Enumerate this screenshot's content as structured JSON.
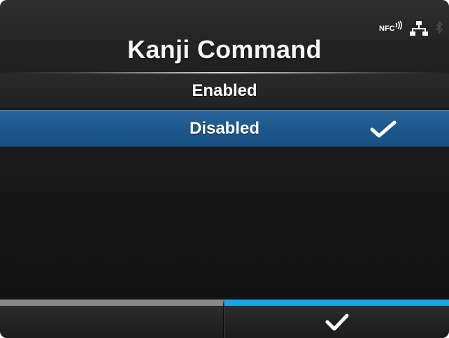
{
  "header": {
    "title": "Kanji Command",
    "status_icons": {
      "nfc_label": "NFC",
      "nfc_icon": "nfc-icon",
      "network_icon": "network-icon",
      "bluetooth_icon": "bluetooth-icon"
    }
  },
  "menu": {
    "items": [
      {
        "label": "Enabled",
        "selected": false
      },
      {
        "label": "Disabled",
        "selected": true
      }
    ],
    "selected_marker_icon": "checkmark-icon"
  },
  "footer": {
    "left_button": {
      "label": "",
      "accent_color": "#888888"
    },
    "right_button": {
      "label": "",
      "icon": "checkmark-icon",
      "accent_color": "#19a6e3"
    }
  },
  "colors": {
    "selected_row": "#1d578d",
    "confirm_accent": "#19a6e3",
    "inactive_accent": "#888888"
  }
}
